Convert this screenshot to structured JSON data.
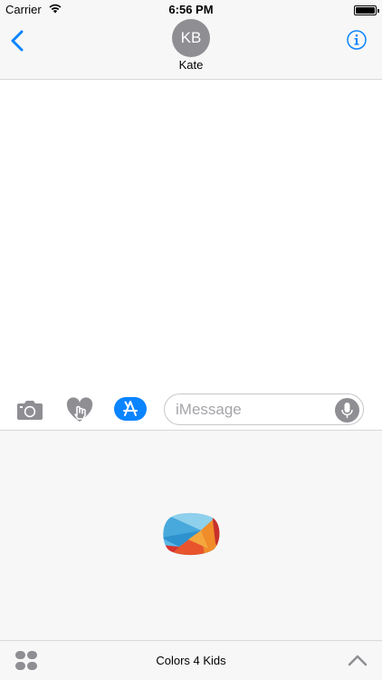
{
  "status_bar": {
    "carrier": "Carrier",
    "time": "6:56 PM"
  },
  "nav": {
    "avatar_initials": "KB",
    "contact_name": "Kate",
    "accent_color": "#0a84ff"
  },
  "input_bar": {
    "message_placeholder": "iMessage",
    "icons": [
      "camera-icon",
      "digital-touch-icon",
      "app-store-icon",
      "microphone-icon"
    ]
  },
  "drawer": {
    "sticker": "colors-4-kids-sticker"
  },
  "bottom_bar": {
    "app_title": "Colors 4 Kids",
    "icons": [
      "app-drawer-icon",
      "expand-chevron-icon"
    ]
  }
}
